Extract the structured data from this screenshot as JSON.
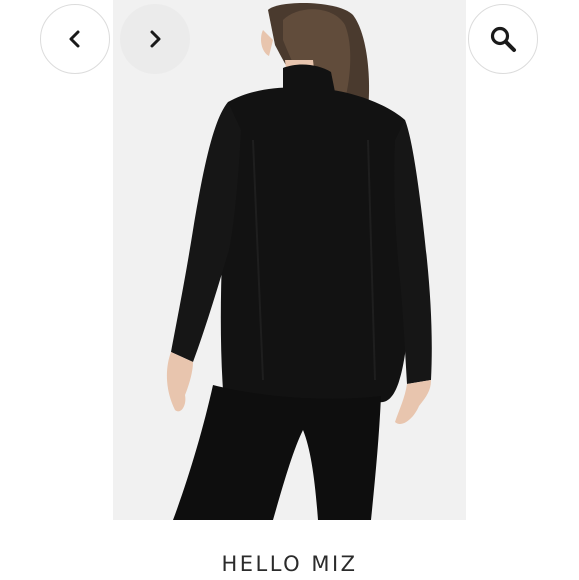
{
  "product": {
    "brand": "HELLO MIZ"
  },
  "controls": {
    "prev_icon": "chevron-left-icon",
    "next_icon": "chevron-right-icon",
    "search_icon": "search-icon"
  },
  "colors": {
    "garment": "#121212",
    "backdrop": "#f1f1f1",
    "hair": "#4a3a2e",
    "skin": "#e8c5ae"
  }
}
